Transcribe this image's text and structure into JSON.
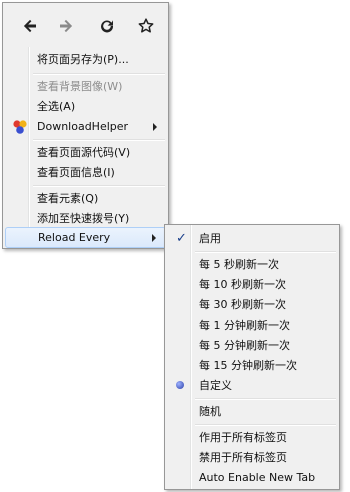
{
  "main_menu": {
    "nav": [
      "back-icon",
      "forward-icon",
      "reload-icon",
      "bookmark-star-icon"
    ],
    "items": [
      {
        "label": "将页面另存为(P)..."
      },
      {
        "label": "查看背景图像(W)"
      },
      {
        "label": "全选(A)"
      },
      {
        "label": "DownloadHelper"
      },
      {
        "label": "查看页面源代码(V)"
      },
      {
        "label": "查看页面信息(I)"
      },
      {
        "label": "查看元素(Q)"
      },
      {
        "label": "添加至快速拨号(Y)"
      },
      {
        "label": "Reload Every"
      }
    ]
  },
  "reload_every_menu": {
    "items": [
      {
        "label": "启用"
      },
      {
        "label": "每 5 秒刷新一次"
      },
      {
        "label": "每 10 秒刷新一次"
      },
      {
        "label": "每 30 秒刷新一次"
      },
      {
        "label": "每 1 分钟刷新一次"
      },
      {
        "label": "每 5 分钟刷新一次"
      },
      {
        "label": "每 15 分钟刷新一次"
      },
      {
        "label": "自定义"
      },
      {
        "label": "随机"
      },
      {
        "label": "作用于所有标签页"
      },
      {
        "label": "禁用于所有标签页"
      },
      {
        "label": "Auto Enable New Tab"
      }
    ]
  }
}
